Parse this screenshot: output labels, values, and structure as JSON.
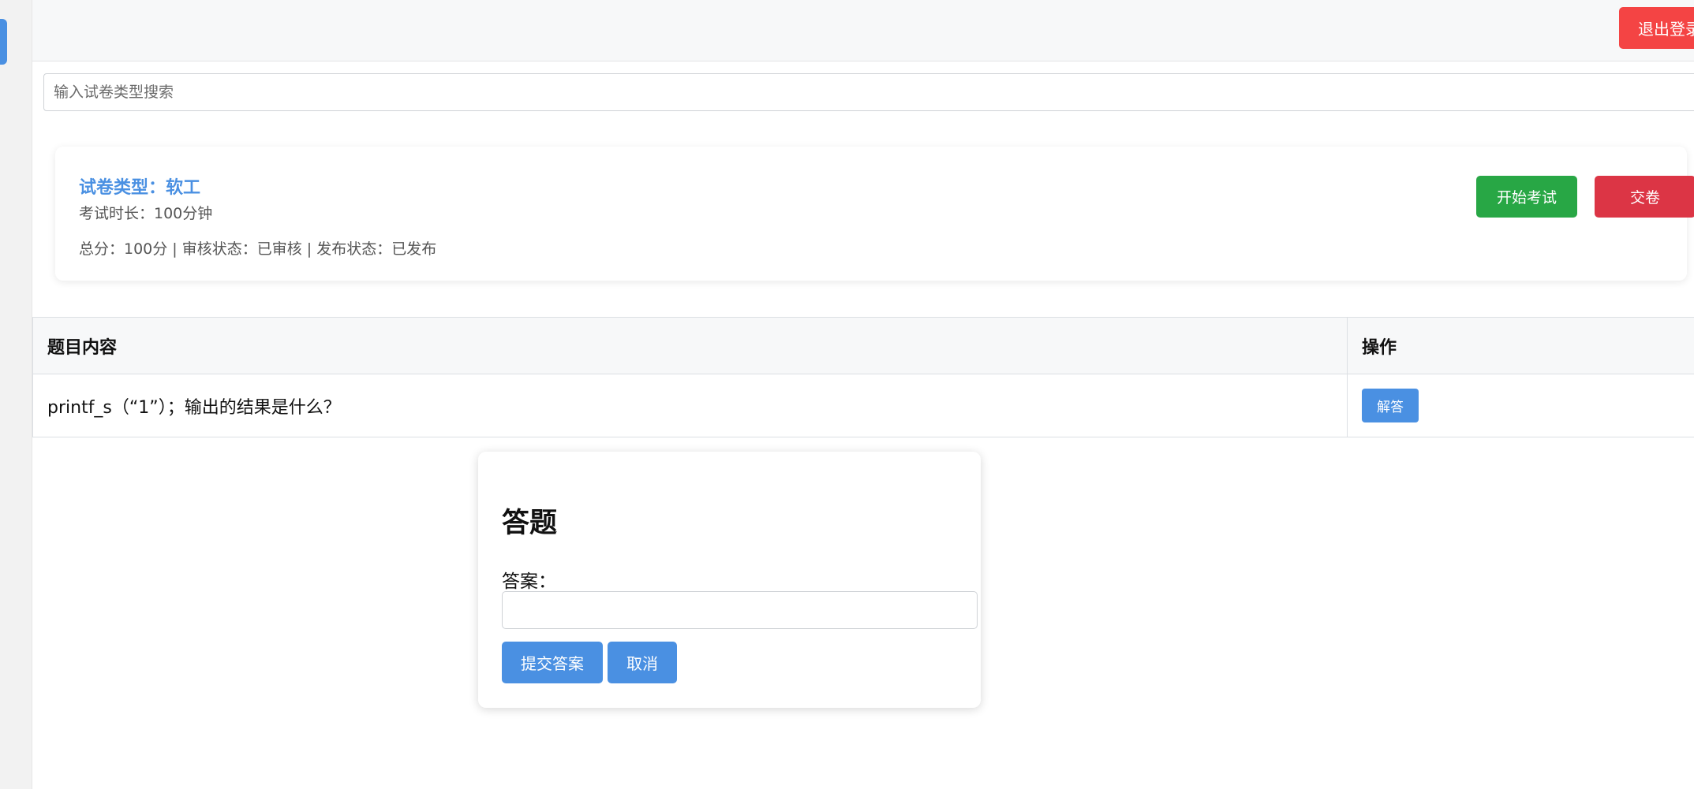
{
  "header": {
    "logout_label": "退出登录"
  },
  "search": {
    "placeholder": "输入试卷类型搜索"
  },
  "exam": {
    "type_text": "试卷类型：软工",
    "duration_text": "考试时长：100分钟",
    "meta_text": "总分：100分 | 审核状态：已审核 | 发布状态：已发布",
    "start_label": "开始考试",
    "submit_label": "交卷"
  },
  "table": {
    "headers": [
      "题目内容",
      "操作"
    ],
    "rows": [
      {
        "question": "printf_s（“1”）；输出的结果是什么？",
        "action_label": "解答"
      }
    ]
  },
  "modal": {
    "title": "答题",
    "answer_label": "答案：",
    "answer_value": "",
    "submit_label": "提交答案",
    "cancel_label": "取消"
  },
  "colors": {
    "primary": "#4a90e2",
    "success": "#28a745",
    "danger": "#dc3545",
    "logout": "#f44444"
  }
}
